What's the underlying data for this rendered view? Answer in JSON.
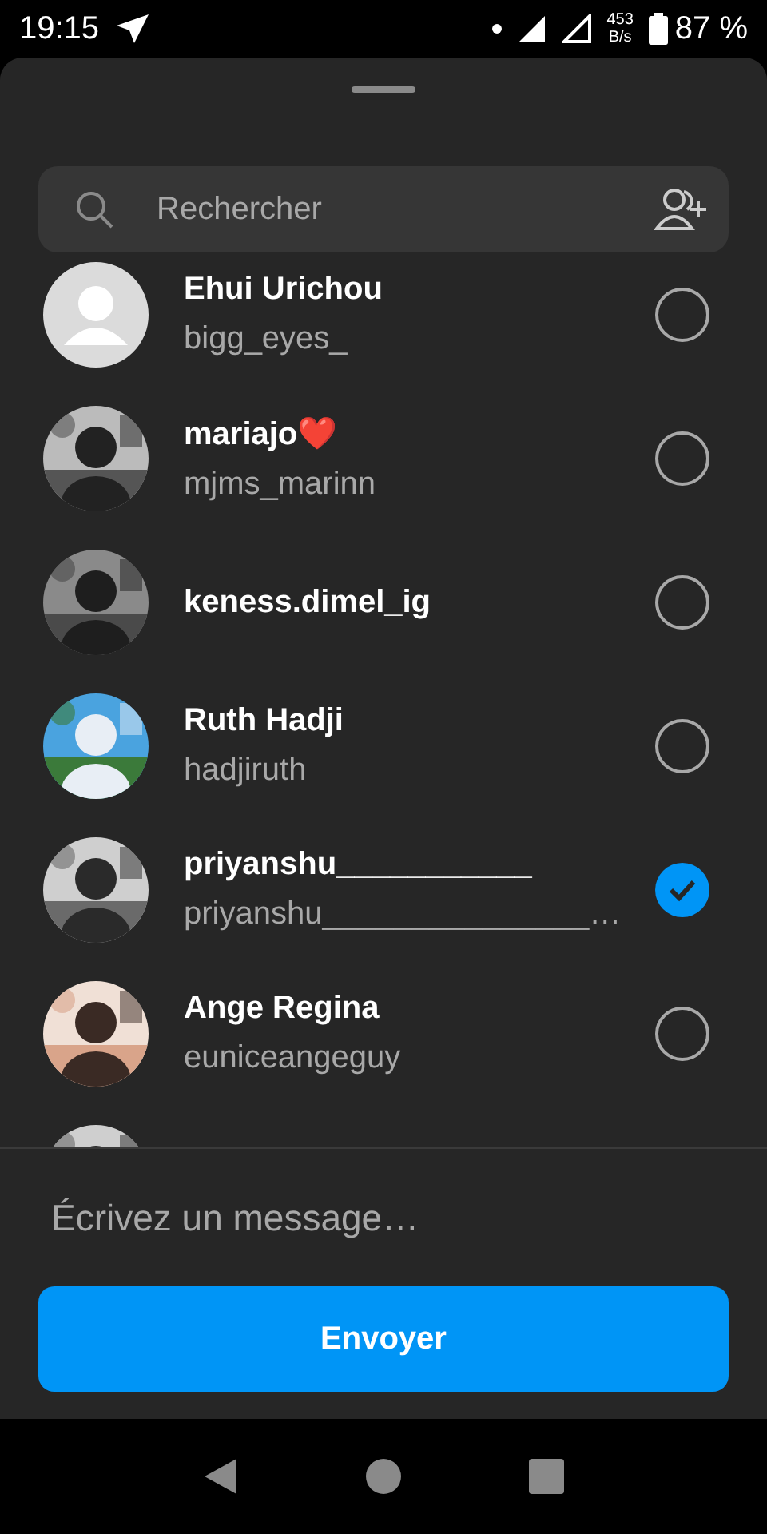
{
  "status_bar": {
    "time": "19:15",
    "speed_value": "453",
    "speed_unit": "B/s",
    "battery": "87 %"
  },
  "search": {
    "placeholder": "Rechercher"
  },
  "contacts": [
    {
      "name": "Ehui Urichou",
      "username": "bigg_eyes_",
      "avatar": {
        "kind": "default"
      },
      "selected": false
    },
    {
      "name": "mariajo❤️",
      "username": "mjms_marinn",
      "selected": false
    },
    {
      "name": "keness.dimel_ig",
      "selected": false
    },
    {
      "name": "Ruth Hadji",
      "username": "hadjiruth",
      "selected": false
    },
    {
      "name": "priyanshu___________",
      "username": "priyanshu_______________…",
      "selected": true
    },
    {
      "name": "Ange Regina",
      "username": "euniceangeguy",
      "selected": false
    }
  ],
  "message": {
    "placeholder": "Écrivez un message…"
  },
  "send_button": {
    "label": "Envoyer"
  }
}
